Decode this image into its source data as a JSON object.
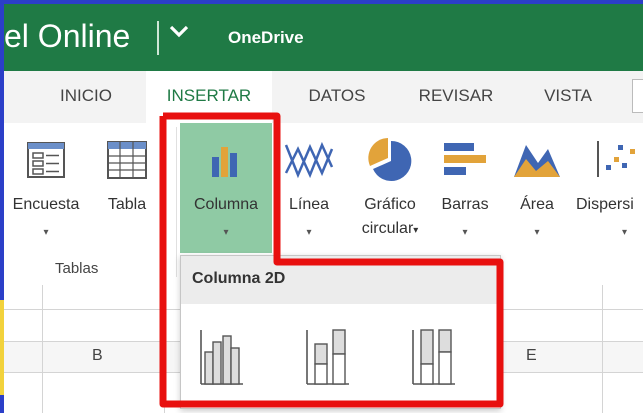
{
  "window": {
    "app_title": "el Online",
    "chevron_glyph": "⌄",
    "service": "OneDrive"
  },
  "tabs": [
    {
      "label": "INICIO",
      "active": false
    },
    {
      "label": "INSERTAR",
      "active": true
    },
    {
      "label": "DATOS",
      "active": false
    },
    {
      "label": "REVISAR",
      "active": false
    },
    {
      "label": "VISTA",
      "active": false
    }
  ],
  "ribbon": {
    "groups": [
      {
        "label": "Tablas"
      }
    ],
    "buttons": [
      {
        "label": "Encuesta",
        "icon": "survey-icon",
        "has_dropdown": true
      },
      {
        "label": "Tabla",
        "icon": "table-icon",
        "has_dropdown": false
      },
      {
        "label": "Columna",
        "icon": "column-chart-icon",
        "has_dropdown": true,
        "selected": true
      },
      {
        "label": "Línea",
        "icon": "line-chart-icon",
        "has_dropdown": true
      },
      {
        "label": "Gráfico",
        "label2": "circular",
        "icon": "pie-chart-icon",
        "has_dropdown": true
      },
      {
        "label": "Barras",
        "icon": "bar-chart-icon",
        "has_dropdown": true
      },
      {
        "label": "Área",
        "icon": "area-chart-icon",
        "has_dropdown": true
      },
      {
        "label": "Dispersi",
        "icon": "scatter-chart-icon",
        "has_dropdown": true
      }
    ],
    "caret_glyph": "▾"
  },
  "dropdown": {
    "title": "Columna 2D",
    "options": [
      {
        "icon": "clustered-column-icon"
      },
      {
        "icon": "stacked-column-icon"
      },
      {
        "icon": "100-stacked-column-icon"
      }
    ]
  },
  "sheet": {
    "columns": [
      "B",
      "E"
    ]
  },
  "colors": {
    "brand_green": "#1f7a45",
    "selected_green": "#8fcaa4",
    "highlight_red": "#e8100f",
    "background_blue": "#2b3fc8"
  }
}
